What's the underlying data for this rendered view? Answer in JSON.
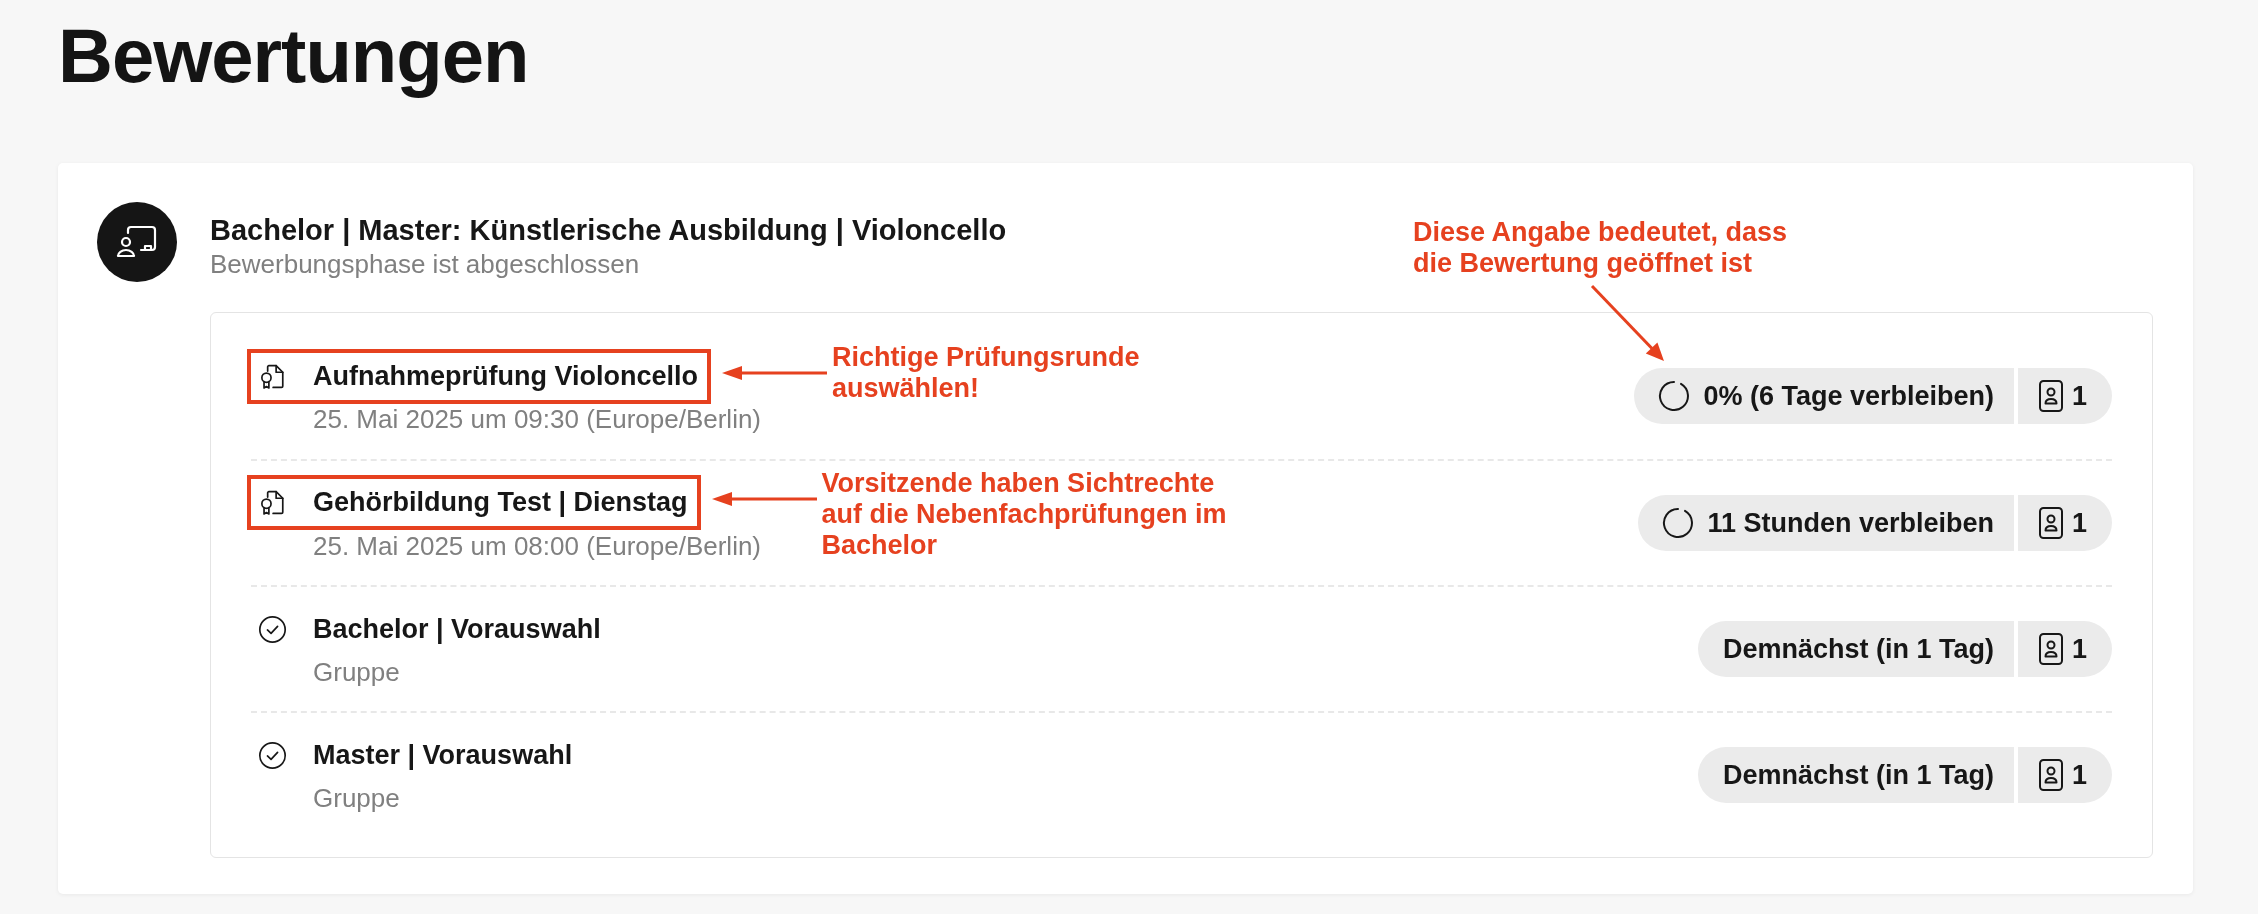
{
  "page": {
    "title": "Bewertungen"
  },
  "program": {
    "title": "Bachelor | Master: Künstlerische Ausbildung | Violoncello",
    "subtitle": "Bewerbungsphase ist abgeschlossen",
    "note": "Diese Angabe bedeutet, dass die Bewertung geöffnet ist"
  },
  "rounds": [
    {
      "kind": "exam",
      "title": "Aufnahmeprüfung Violoncello",
      "subtitle": "25. Mai 2025 um 09:30 (Europe/Berlin)",
      "highlighted": true,
      "callout": "Richtige Prüfungsrunde auswählen!",
      "status": {
        "kind": "running",
        "text": "0% (6 Tage verbleiben)"
      },
      "count": "1"
    },
    {
      "kind": "exam",
      "title": "Gehörbildung Test | Dienstag",
      "subtitle": "25. Mai 2025 um 08:00 (Europe/Berlin)",
      "highlighted": true,
      "callout": "Vorsitzende haben Sichtrechte auf die Nebenfachprüfungen im Bachelor",
      "status": {
        "kind": "running",
        "text": "11 Stunden verbleiben"
      },
      "count": "1"
    },
    {
      "kind": "group",
      "title": "Bachelor | Vorauswahl",
      "subtitle": "Gruppe",
      "highlighted": false,
      "status": {
        "kind": "upcoming",
        "text": "Demnächst (in 1 Tag)"
      },
      "count": "1"
    },
    {
      "kind": "group",
      "title": "Master | Vorauswahl",
      "subtitle": "Gruppe",
      "highlighted": false,
      "status": {
        "kind": "upcoming",
        "text": "Demnächst (in 1 Tag)"
      },
      "count": "1"
    }
  ]
}
